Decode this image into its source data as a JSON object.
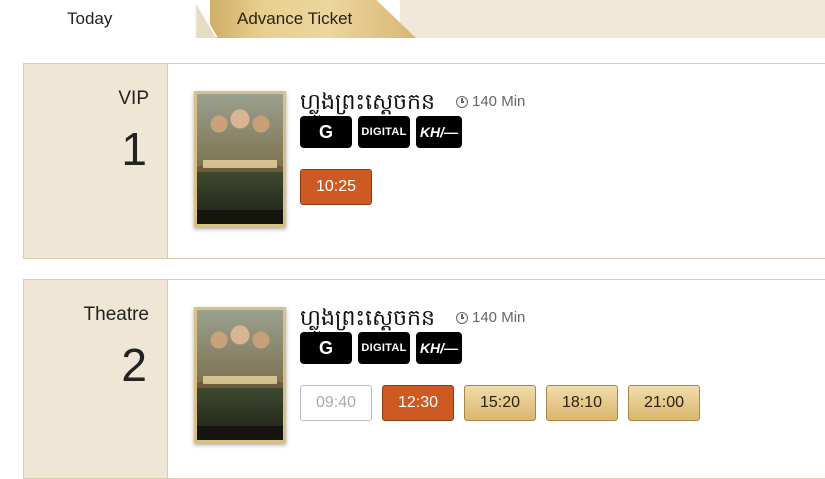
{
  "tabs": {
    "today": "Today",
    "advance": "Advance Ticket"
  },
  "halls": [
    {
      "type": "VIP",
      "number": "1",
      "movie_title": "ហ្លួងព្រះស្ដេចកន",
      "duration": "140 Min",
      "badges": {
        "rating": "G",
        "format": "DIGITAL",
        "language": "KH/—"
      },
      "showtimes": [
        {
          "time": "10:25",
          "state": "active"
        }
      ]
    },
    {
      "type": "Theatre",
      "number": "2",
      "movie_title": "ហ្លួងព្រះស្ដេចកន",
      "duration": "140 Min",
      "badges": {
        "rating": "G",
        "format": "DIGITAL",
        "language": "KH/—"
      },
      "showtimes": [
        {
          "time": "09:40",
          "state": "past"
        },
        {
          "time": "12:30",
          "state": "active"
        },
        {
          "time": "15:20",
          "state": "available"
        },
        {
          "time": "18:10",
          "state": "available"
        },
        {
          "time": "21:00",
          "state": "available"
        }
      ]
    }
  ],
  "colors": {
    "active": "#cc5a22",
    "available": "#e3c483",
    "panel": "#efe6d6",
    "border": "#d9ccb0"
  }
}
